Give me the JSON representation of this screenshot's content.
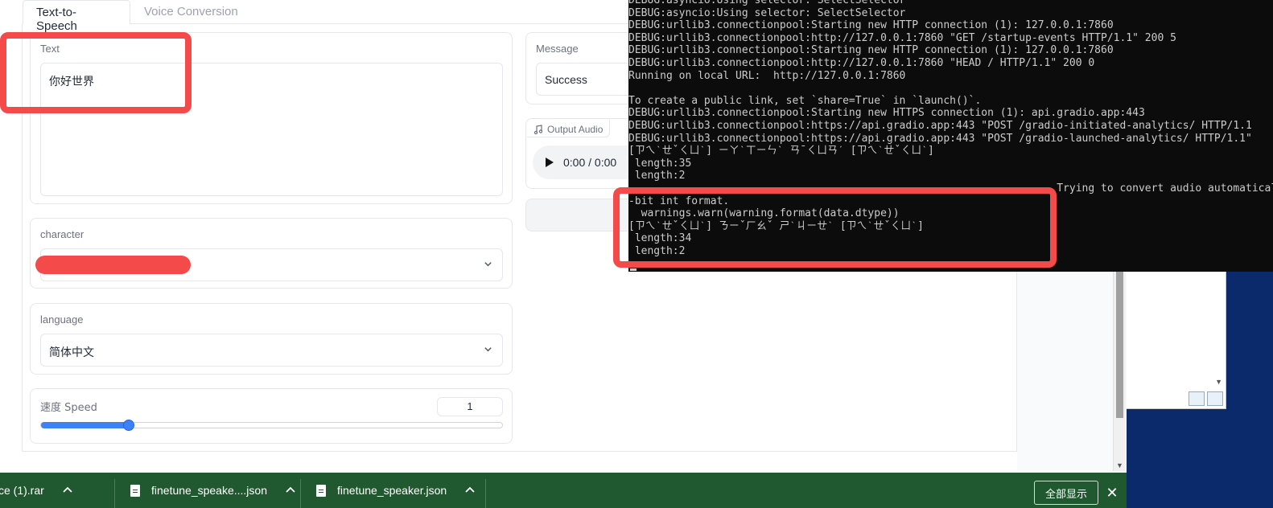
{
  "tabs": [
    {
      "label": "Text-to-Speech",
      "active": true
    },
    {
      "label": "Voice Conversion",
      "active": false
    }
  ],
  "text_panel": {
    "label": "Text",
    "value": "你好世界"
  },
  "character_panel": {
    "label": "character",
    "value": ""
  },
  "language_panel": {
    "label": "language",
    "value": "简体中文"
  },
  "speed_panel": {
    "label": "速度 Speed",
    "value": "1",
    "slider_fraction": 0.19
  },
  "message_panel": {
    "label": "Message",
    "value": "Success"
  },
  "audio_panel": {
    "label": "Output Audio",
    "time": "0:00 / 0:00"
  },
  "console": {
    "lines": [
      "DEBUG:asyncio:Using selector: SelectSelector",
      "DEBUG:asyncio:Using selector: SelectSelector",
      "DEBUG:urllib3.connectionpool:Starting new HTTP connection (1): 127.0.0.1:7860",
      "DEBUG:urllib3.connectionpool:http://127.0.0.1:7860 \"GET /startup-events HTTP/1.1\" 200 5",
      "DEBUG:urllib3.connectionpool:Starting new HTTP connection (1): 127.0.0.1:7860",
      "DEBUG:urllib3.connectionpool:http://127.0.0.1:7860 \"HEAD / HTTP/1.1\" 200 0",
      "Running on local URL:  http://127.0.0.1:7860",
      "",
      "To create a public link, set `share=True` in `launch()`.",
      "DEBUG:urllib3.connectionpool:Starting new HTTPS connection (1): api.gradio.app:443",
      "DEBUG:urllib3.connectionpool:https://api.gradio.app:443 \"POST /gradio-initiated-analytics/ HTTP/1.1",
      "DEBUG:urllib3.connectionpool:https://api.gradio.app:443 \"POST /gradio-launched-analytics/ HTTP/1.1\"",
      "[ㄗㄟˋㄝˇㄑㄩˋ] ㄧㄚˋㄒㄧㄣˋ ㄢˉㄑㄩㄢˊ [ㄗㄟˋㄝˇㄑㄩˋ]",
      " length:35",
      " length:2",
      "                                                                    Trying to convert audio automatical",
      "-bit int format.",
      "  warnings.warn(warning.format(data.dtype))",
      "[ㄗㄟˋㄝˇㄑㄩˋ] ㄋㄧˇㄏㄠˇ ㄕˋㄐㄧㄝˋ [ㄗㄟˋㄝˇㄑㄩˋ]",
      " length:34",
      " length:2"
    ]
  },
  "downloads": {
    "items": [
      {
        "name": "ce (1).rar"
      },
      {
        "name": "finetune_speake....json"
      },
      {
        "name": "finetune_speaker.json"
      }
    ],
    "show_all": "全部显示"
  },
  "colors": {
    "accent": "#3b82f6",
    "highlight": "#f44a4a",
    "download_bar": "#20582f",
    "console_bg": "#0c0c0c"
  }
}
